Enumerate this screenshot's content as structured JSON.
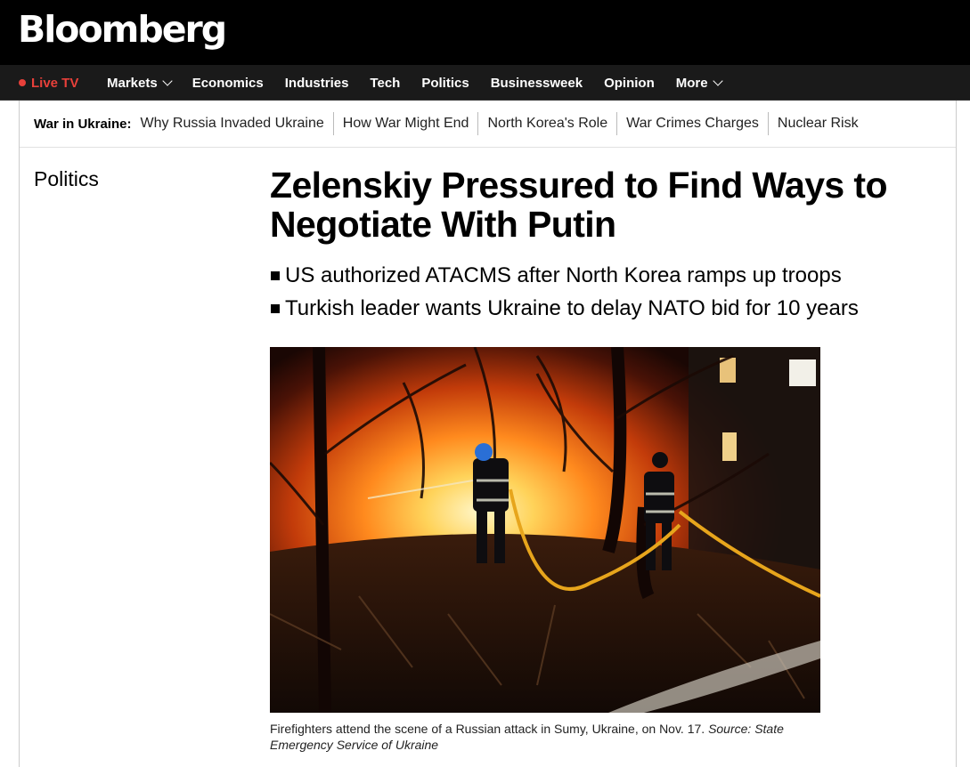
{
  "brand": {
    "logo": "Bloomberg"
  },
  "nav": {
    "live_tv": "Live TV",
    "items": [
      {
        "label": "Markets",
        "dropdown": true
      },
      {
        "label": "Economics",
        "dropdown": false
      },
      {
        "label": "Industries",
        "dropdown": false
      },
      {
        "label": "Tech",
        "dropdown": false
      },
      {
        "label": "Politics",
        "dropdown": false
      },
      {
        "label": "Businessweek",
        "dropdown": false
      },
      {
        "label": "Opinion",
        "dropdown": false
      },
      {
        "label": "More",
        "dropdown": true
      }
    ]
  },
  "subnav": {
    "label": "War in Ukraine:",
    "links": [
      "Why Russia Invaded Ukraine",
      "How War Might End",
      "North Korea's Role",
      "War Crimes Charges",
      "Nuclear Risk"
    ]
  },
  "article": {
    "section": "Politics",
    "headline": "Zelenskiy Pressured to Find Ways to Negotiate With Putin",
    "bullets": [
      "US authorized ATACMS after North Korea ramps up troops",
      "Turkish leader wants Ukraine to delay NATO bid for 10 years"
    ],
    "image_caption": "Firefighters attend the scene of a Russian attack in Sumy, Ukraine, on Nov. 17.",
    "image_source": "Source: State Emergency Service of Ukraine"
  },
  "colors": {
    "live_red": "#e8403a",
    "topbar": "#000000",
    "navbar": "#1a1a1a"
  }
}
